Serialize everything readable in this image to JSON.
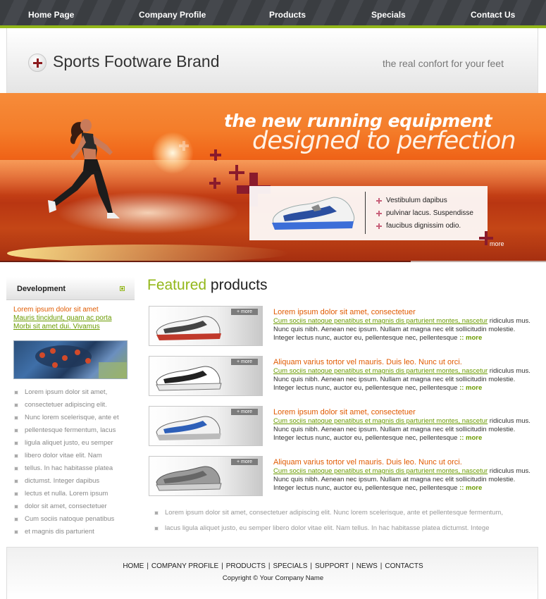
{
  "nav": {
    "items": [
      "Home Page",
      "Company Profile",
      "Products",
      "Specials",
      "Contact Us"
    ]
  },
  "header": {
    "brand": "Sports Footware Brand",
    "tagline": "the real confort for your feet"
  },
  "hero": {
    "headline1": "the new running equipment",
    "headline2": "designed to perfection",
    "bullets": [
      "Vestibulum dapibus",
      "pulvinar lacus. Suspendisse",
      "faucibus dignissim odio."
    ],
    "more": "more"
  },
  "sidebar": {
    "title": "Development",
    "promo": "Lorem ipsum dolor sit amet",
    "links": [
      "Mauris tincidunt, quam ac porta",
      "Morbi sit amet dui. Vivamus"
    ],
    "list": [
      "Lorem ipsum dolor sit amet,",
      "consectetuer adipiscing elit.",
      "Nunc lorem scelerisque, ante et",
      "pellentesque fermentum, lacus",
      "ligula aliquet justo, eu semper",
      "libero dolor vitae elit. Nam",
      "tellus. In hac habitasse platea",
      "dictumst. Integer dapibus",
      "lectus et nulla. Lorem ipsum",
      "dolor sit amet, consectetuer",
      "Cum sociis natoque penatibus",
      "et magnis dis parturient"
    ]
  },
  "featured": {
    "title_a": "Featured",
    "title_b": "products",
    "thumb_more": "+ more",
    "products": [
      {
        "title": "Lorem ipsum dolor sit amet, consectetuer",
        "link": "Cum sociis natoque penatibus et magnis dis parturient montes, nascetur",
        "text": " ridiculus mus. Nunc quis nibh. Aenean nec ipsum. Nullam at magna nec elit sollicitudin molestie. Integer lectus nunc, auctor eu, pellentesque nec, pellentesque",
        "more": ":: more"
      },
      {
        "title": "Aliquam varius tortor vel mauris. Duis leo. Nunc ut orci.",
        "link": "Cum sociis natoque penatibus et magnis dis parturient montes, nascetur",
        "text": " ridiculus mus. Nunc quis nibh. Aenean nec ipsum. Nullam at magna nec elit sollicitudin molestie. Integer lectus nunc, auctor eu, pellentesque nec, pellentesque",
        "more": ":: more"
      },
      {
        "title": "Lorem ipsum dolor sit amet, consectetuer",
        "link": "Cum sociis natoque penatibus et magnis dis parturient montes, nascetur",
        "text": " ridiculus mus. Nunc quis nibh. Aenean nec ipsum. Nullam at magna nec elit sollicitudin molestie. Integer lectus nunc, auctor eu, pellentesque nec, pellentesque",
        "more": ":: more"
      },
      {
        "title": "Aliquam varius tortor vel mauris. Duis leo. Nunc ut orci.",
        "link": "Cum sociis natoque penatibus et magnis dis parturient montes, nascetur",
        "text": " ridiculus mus. Nunc quis nibh. Aenean nec ipsum. Nullam at magna nec elit sollicitudin molestie. Integer lectus nunc, auctor eu, pellentesque nec, pellentesque",
        "more": ":: more"
      }
    ],
    "bottom_list": [
      "Lorem ipsum dolor sit amet, consectetuer adipiscing elit. Nunc lorem scelerisque, ante et pellentesque fermentum,",
      "lacus ligula aliquet justo, eu semper libero dolor vitae elit. Nam tellus. In hac habitasse platea dictumst. Intege"
    ]
  },
  "footer": {
    "links": [
      "HOME",
      "COMPANY PROFILE",
      "PRODUCTS",
      "SPECIALS",
      "SUPPORT",
      "NEWS",
      "CONTACTS"
    ],
    "copyright": "Copyright © Your Company Name"
  },
  "colors": {
    "accent_green": "#93b71a",
    "accent_orange": "#e05a00",
    "nav_dark": "#3a3d41",
    "cross_red": "#8a1b2c"
  }
}
